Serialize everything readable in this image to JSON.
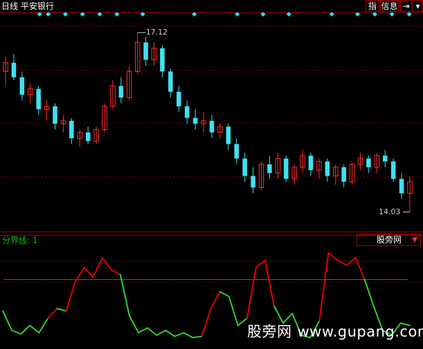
{
  "header": {
    "title": "日线  平安银行",
    "buttons": {
      "indicator": "指",
      "info": "信息",
      "exit": "⇥",
      "close": "▾"
    }
  },
  "price_panel": {
    "high_label": "17.12",
    "low_label": "14.03"
  },
  "indicator_panel": {
    "label": "分界线: 1",
    "selector_value": "股旁网",
    "selector_arrow": "▼"
  },
  "watermark": {
    "cn": "股旁网",
    "url": "www.gupang.com"
  },
  "colors": {
    "up": "#ff3030",
    "down": "#40e0f0",
    "grid": "#7a0000",
    "line_high": "#e00000",
    "line_low": "#30d030",
    "baseline": "#00a000",
    "diamond": "#30e0f0"
  },
  "chart_data": [
    {
      "type": "candlestick",
      "title": "日线 平安银行",
      "high": 17.12,
      "low": 14.03,
      "ylim": [
        13.8,
        17.3
      ],
      "candles": [
        {
          "o": 16.45,
          "h": 16.7,
          "l": 16.2,
          "c": 16.6
        },
        {
          "o": 16.6,
          "h": 16.75,
          "l": 16.3,
          "c": 16.35
        },
        {
          "o": 16.35,
          "h": 16.45,
          "l": 15.95,
          "c": 16.05
        },
        {
          "o": 16.05,
          "h": 16.25,
          "l": 15.9,
          "c": 16.15
        },
        {
          "o": 16.15,
          "h": 16.2,
          "l": 15.7,
          "c": 15.8
        },
        {
          "o": 15.8,
          "h": 15.95,
          "l": 15.6,
          "c": 15.85
        },
        {
          "o": 15.85,
          "h": 15.9,
          "l": 15.45,
          "c": 15.55
        },
        {
          "o": 15.55,
          "h": 15.7,
          "l": 15.4,
          "c": 15.6
        },
        {
          "o": 15.6,
          "h": 15.65,
          "l": 15.2,
          "c": 15.3
        },
        {
          "o": 15.3,
          "h": 15.45,
          "l": 15.15,
          "c": 15.4
        },
        {
          "o": 15.4,
          "h": 15.5,
          "l": 15.2,
          "c": 15.25
        },
        {
          "o": 15.25,
          "h": 15.5,
          "l": 15.2,
          "c": 15.45
        },
        {
          "o": 15.45,
          "h": 15.9,
          "l": 15.4,
          "c": 15.85
        },
        {
          "o": 15.85,
          "h": 16.3,
          "l": 15.8,
          "c": 16.2
        },
        {
          "o": 16.2,
          "h": 16.35,
          "l": 15.9,
          "c": 16.0
        },
        {
          "o": 16.0,
          "h": 16.55,
          "l": 15.95,
          "c": 16.45
        },
        {
          "o": 16.45,
          "h": 17.12,
          "l": 16.4,
          "c": 16.95
        },
        {
          "o": 16.95,
          "h": 17.05,
          "l": 16.55,
          "c": 16.65
        },
        {
          "o": 16.65,
          "h": 16.95,
          "l": 16.55,
          "c": 16.85
        },
        {
          "o": 16.85,
          "h": 16.9,
          "l": 16.35,
          "c": 16.45
        },
        {
          "o": 16.45,
          "h": 16.5,
          "l": 16.0,
          "c": 16.1
        },
        {
          "o": 16.1,
          "h": 16.2,
          "l": 15.75,
          "c": 15.85
        },
        {
          "o": 15.85,
          "h": 15.95,
          "l": 15.55,
          "c": 15.65
        },
        {
          "o": 15.65,
          "h": 15.8,
          "l": 15.45,
          "c": 15.55
        },
        {
          "o": 15.55,
          "h": 15.75,
          "l": 15.4,
          "c": 15.6
        },
        {
          "o": 15.6,
          "h": 15.7,
          "l": 15.3,
          "c": 15.4
        },
        {
          "o": 15.4,
          "h": 15.55,
          "l": 15.3,
          "c": 15.5
        },
        {
          "o": 15.5,
          "h": 15.55,
          "l": 15.1,
          "c": 15.2
        },
        {
          "o": 15.2,
          "h": 15.3,
          "l": 14.85,
          "c": 14.95
        },
        {
          "o": 14.95,
          "h": 15.05,
          "l": 14.55,
          "c": 14.65
        },
        {
          "o": 14.65,
          "h": 14.8,
          "l": 14.35,
          "c": 14.45
        },
        {
          "o": 14.45,
          "h": 14.9,
          "l": 14.4,
          "c": 14.85
        },
        {
          "o": 14.85,
          "h": 15.0,
          "l": 14.6,
          "c": 14.7
        },
        {
          "o": 14.7,
          "h": 15.05,
          "l": 14.6,
          "c": 14.95
        },
        {
          "o": 14.95,
          "h": 15.0,
          "l": 14.55,
          "c": 14.6
        },
        {
          "o": 14.6,
          "h": 14.85,
          "l": 14.5,
          "c": 14.8
        },
        {
          "o": 14.8,
          "h": 15.1,
          "l": 14.7,
          "c": 15.0
        },
        {
          "o": 15.0,
          "h": 15.05,
          "l": 14.65,
          "c": 14.75
        },
        {
          "o": 14.75,
          "h": 14.95,
          "l": 14.6,
          "c": 14.9
        },
        {
          "o": 14.9,
          "h": 14.95,
          "l": 14.55,
          "c": 14.65
        },
        {
          "o": 14.65,
          "h": 14.85,
          "l": 14.5,
          "c": 14.8
        },
        {
          "o": 14.8,
          "h": 14.85,
          "l": 14.45,
          "c": 14.55
        },
        {
          "o": 14.55,
          "h": 14.9,
          "l": 14.5,
          "c": 14.85
        },
        {
          "o": 14.85,
          "h": 15.05,
          "l": 14.75,
          "c": 14.95
        },
        {
          "o": 14.95,
          "h": 15.0,
          "l": 14.7,
          "c": 14.8
        },
        {
          "o": 14.8,
          "h": 15.05,
          "l": 14.7,
          "c": 15.0
        },
        {
          "o": 15.0,
          "h": 15.1,
          "l": 14.8,
          "c": 14.9
        },
        {
          "o": 14.9,
          "h": 14.95,
          "l": 14.55,
          "c": 14.6
        },
        {
          "o": 14.6,
          "h": 14.7,
          "l": 14.25,
          "c": 14.35
        },
        {
          "o": 14.35,
          "h": 14.65,
          "l": 14.03,
          "c": 14.55
        }
      ]
    },
    {
      "type": "line",
      "title": "分界线: 1",
      "baseline": 1,
      "ylim": [
        0,
        4.2
      ],
      "values": [
        1.4,
        0.6,
        0.45,
        0.8,
        0.5,
        1.1,
        1.5,
        1.4,
        2.6,
        3.2,
        2.8,
        3.6,
        3.1,
        2.9,
        1.2,
        0.5,
        0.7,
        0.4,
        0.6,
        0.35,
        0.5,
        0.3,
        0.35,
        1.5,
        2.2,
        2.0,
        0.8,
        1.1,
        3.2,
        3.5,
        1.6,
        0.9,
        1.3,
        0.4,
        0.3,
        1.0,
        3.8,
        3.5,
        3.3,
        3.6,
        2.7,
        1.6,
        0.6,
        0.4,
        0.9,
        0.8
      ]
    }
  ]
}
